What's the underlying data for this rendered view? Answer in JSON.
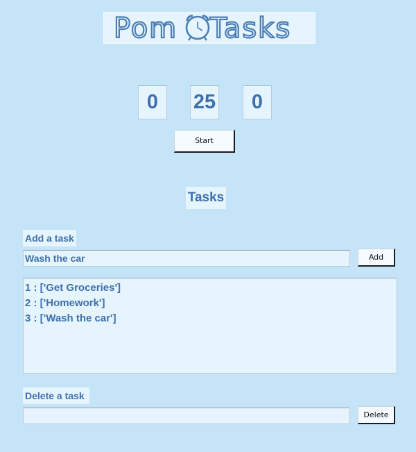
{
  "app": {
    "logo_text": "PomoTasks",
    "logo_left": "Pom",
    "logo_right": "Tasks"
  },
  "timer": {
    "hours": "0",
    "minutes": "25",
    "seconds": "0",
    "start_label": "Start"
  },
  "tasks": {
    "heading": "Tasks",
    "add_label": "Add a task",
    "add_input_value": "Wash the car",
    "add_button_label": "Add",
    "items": [
      "1 : ['Get Groceries']",
      "2 : ['Homework']",
      "3 : ['Wash the car']"
    ],
    "delete_label": "Delete a task",
    "delete_input_value": "",
    "delete_button_label": "Delete"
  },
  "colors": {
    "background": "#c6e4f8",
    "field_background": "#e6f4fd",
    "accent_text": "#3d70ad",
    "logo_outline": "#4a7fb5"
  },
  "icons": {
    "logo_clock": "alarm-clock-icon"
  }
}
